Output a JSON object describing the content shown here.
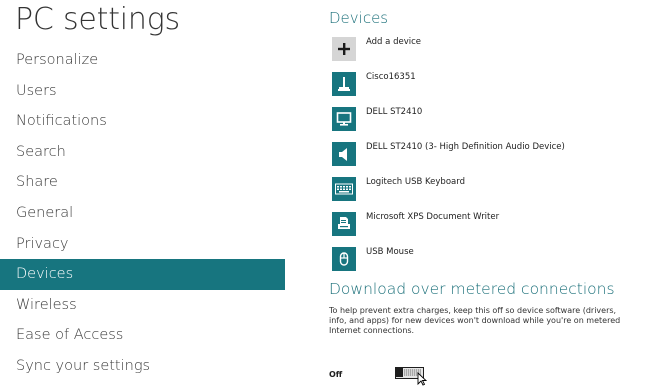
{
  "sidebar": {
    "title": "PC settings",
    "items": [
      {
        "label": "Personalize"
      },
      {
        "label": "Users"
      },
      {
        "label": "Notifications"
      },
      {
        "label": "Search"
      },
      {
        "label": "Share"
      },
      {
        "label": "General"
      },
      {
        "label": "Privacy"
      },
      {
        "label": "Devices",
        "selected": true
      },
      {
        "label": "Wireless"
      },
      {
        "label": "Ease of Access"
      },
      {
        "label": "Sync your settings"
      }
    ]
  },
  "devices": {
    "title": "Devices",
    "items": [
      {
        "label": "Add a device",
        "icon": "plus-icon"
      },
      {
        "label": "Cisco16351",
        "icon": "network-device-icon"
      },
      {
        "label": "DELL ST2410",
        "icon": "monitor-icon"
      },
      {
        "label": "DELL ST2410 (3- High Definition Audio Device)",
        "icon": "speaker-icon"
      },
      {
        "label": "Logitech USB Keyboard",
        "icon": "keyboard-icon"
      },
      {
        "label": "Microsoft XPS Document Writer",
        "icon": "printer-icon"
      },
      {
        "label": "USB Mouse",
        "icon": "mouse-icon"
      }
    ]
  },
  "metered": {
    "title": "Download over metered connections",
    "description": "To help prevent extra charges, keep this off so device software (drivers, info, and apps) for new devices won't download while you're on metered Internet connections.",
    "toggle_label": "Off",
    "toggle_on": false
  },
  "colors": {
    "accent": "#17757f",
    "heading": "#1a6f79",
    "add_tile": "#d5d5d5"
  }
}
